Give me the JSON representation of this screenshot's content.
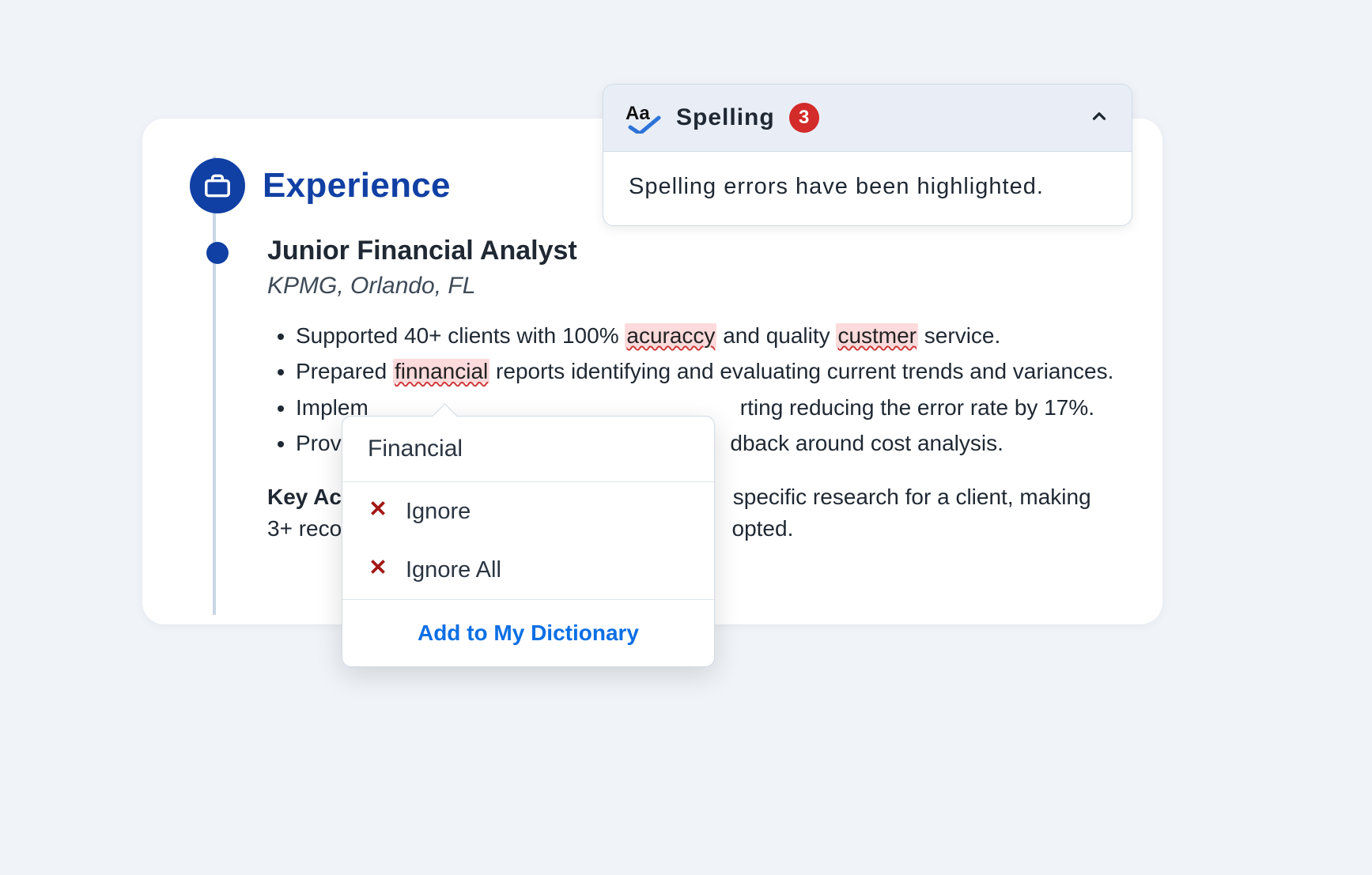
{
  "section_title": "Experience",
  "job": {
    "title": "Junior Financial Analyst",
    "company": "KPMG, Orlando, FL"
  },
  "bullets": {
    "b1_pre": "Supported 40+ clients with 100% ",
    "b1_err1": "acuraccy",
    "b1_mid": " and quality ",
    "b1_err2": "custmer",
    "b1_post": " service.",
    "b2_pre": "Prepared ",
    "b2_err": "finnancial",
    "b2_post": " reports identifying and evaluating current trends and variances.",
    "b3": "Implem",
    "b3_tail": "rting reducing the error rate by 17%.",
    "b4": "Provid",
    "b4_tail": "dback around cost analysis."
  },
  "achievement": {
    "label": "Key Achi",
    "head": "Key Achi",
    "text_a": "3+  recom",
    "mid": "specific research for a client, making",
    "tail": "opted."
  },
  "spell_panel": {
    "title": "Spelling",
    "count": "3",
    "body": "Spelling errors have been highlighted."
  },
  "popup": {
    "suggestion": "Financial",
    "ignore": "Ignore",
    "ignore_all": "Ignore All",
    "add": "Add to My Dictionary"
  }
}
